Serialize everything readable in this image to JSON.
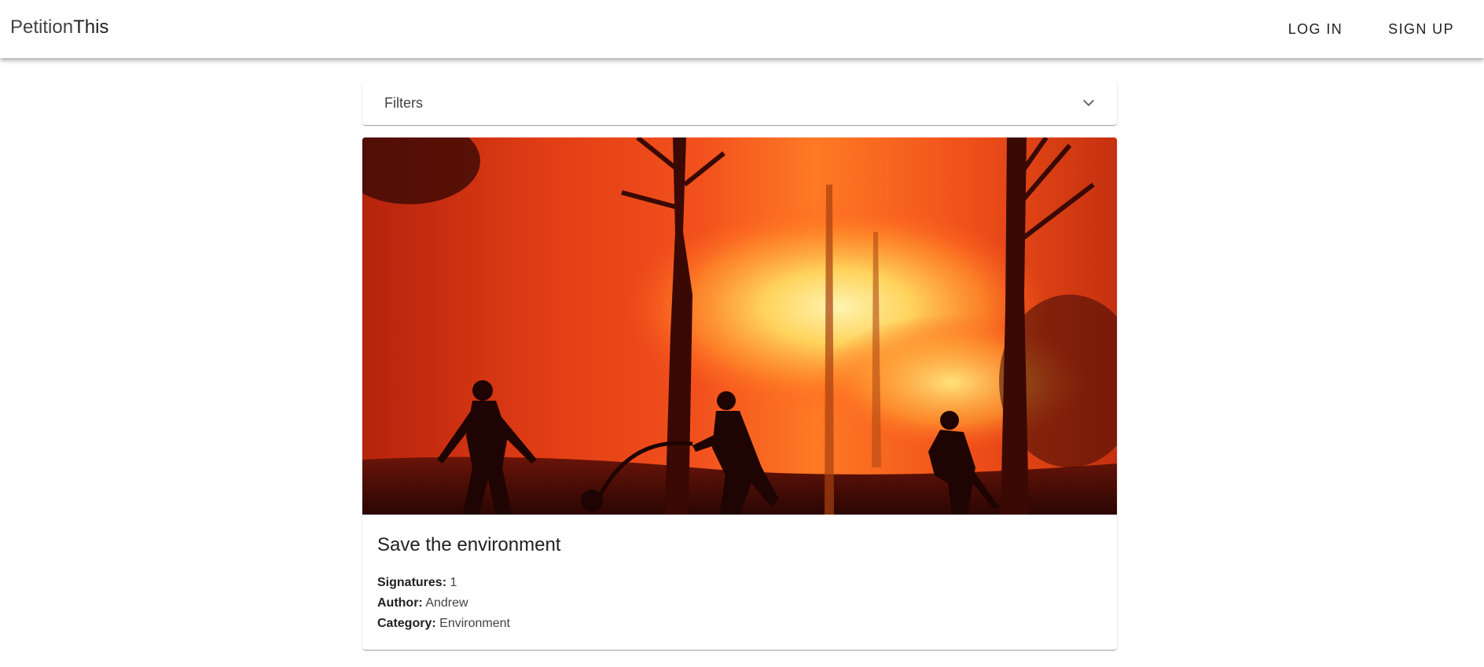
{
  "app": {
    "brand_part1": "Petition",
    "brand_part2": "This"
  },
  "nav": {
    "login_label": "LOG IN",
    "signup_label": "SIGN UP"
  },
  "filters": {
    "label": "Filters",
    "icon": "chevron-down-icon"
  },
  "petitions": [
    {
      "title": "Save the environment",
      "image_description_icon": "bushfire-photo",
      "signatures_label": "Signatures:",
      "signatures_value": "1",
      "author_label": "Author:",
      "author_value": "Andrew",
      "category_label": "Category:",
      "category_value": "Environment"
    }
  ],
  "colors": {
    "appbar_bg": "#ffffff",
    "page_bg": "#ffffff",
    "text_primary": "#212121",
    "fire_orange": "#f2511d",
    "fire_yellow": "#ffe27a"
  }
}
